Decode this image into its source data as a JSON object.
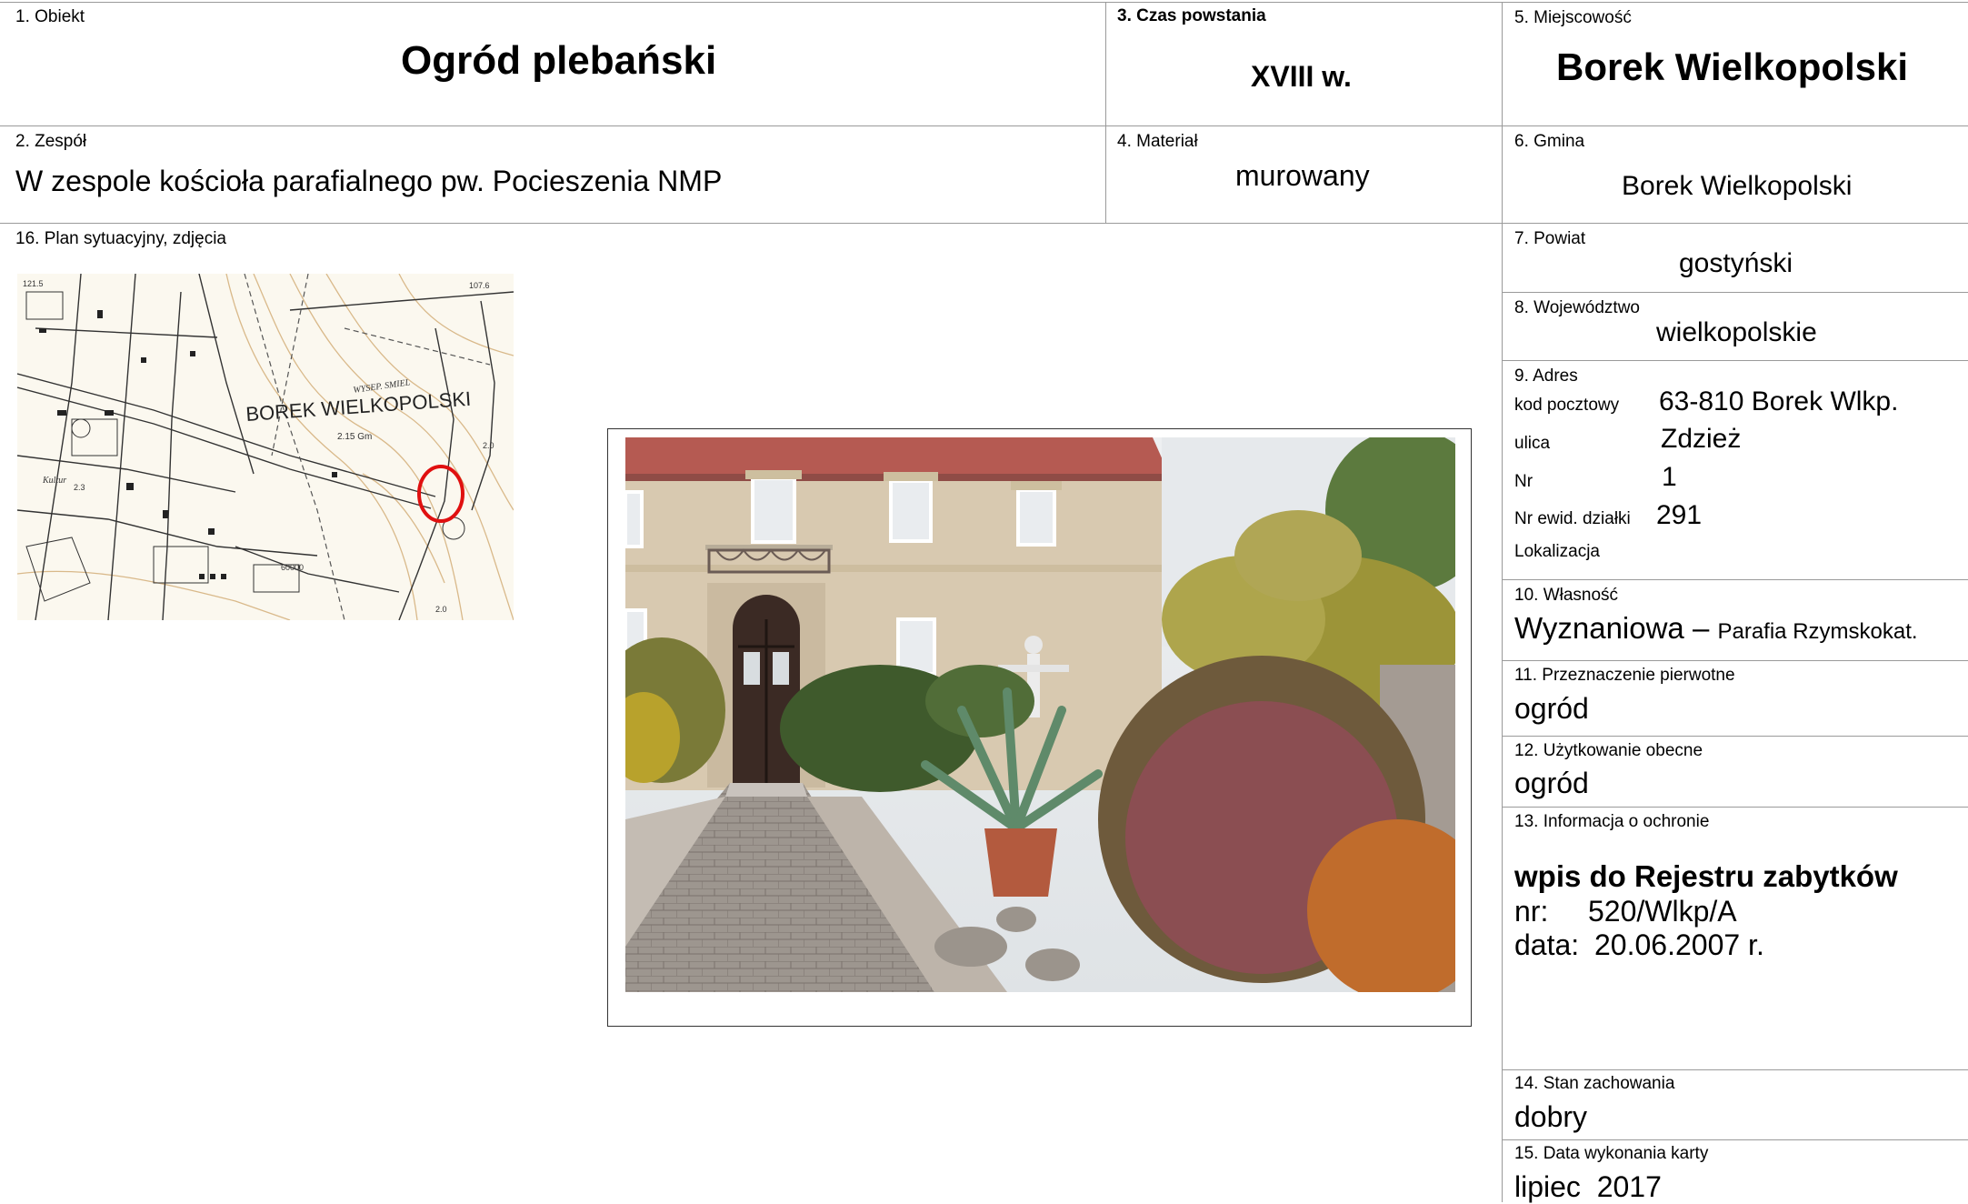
{
  "fields": {
    "obiekt": {
      "label": "1. Obiekt",
      "value": "Ogród plebański"
    },
    "zespol": {
      "label": "2. Zespół",
      "value": "W zespole kościoła parafialnego pw. Pocieszenia NMP"
    },
    "czas": {
      "label": "3. Czas powstania",
      "value": "XVIII w."
    },
    "material": {
      "label": "4. Materiał",
      "value": "murowany"
    },
    "miejscowosc": {
      "label": "5. Miejscowość",
      "value": "Borek Wielkopolski"
    },
    "gmina": {
      "label": "6. Gmina",
      "value": "Borek Wielkopolski"
    },
    "powiat": {
      "label": "7. Powiat",
      "value": "gostyński"
    },
    "wojewodztwo": {
      "label": "8. Województwo",
      "value": "wielkopolskie"
    },
    "adres": {
      "label": "9. Adres",
      "kod_label": "kod pocztowy",
      "kod": "63-810 Borek Wlkp.",
      "ulica_label": "ulica",
      "ulica": "Zdzież",
      "nr_label": "Nr",
      "nr": "1",
      "dzialka_label": "Nr ewid. działki",
      "dzialka": "291",
      "lokalizacja_label": "Lokalizacja"
    },
    "wlasnosc": {
      "label": "10. Własność",
      "value_main": "Wyznaniowa –",
      "value_sub": "Parafia Rzymskokat."
    },
    "przeznaczenie": {
      "label": "11. Przeznaczenie pierwotne",
      "value": "ogród"
    },
    "uzytkowanie": {
      "label": "12. Użytkowanie obecne",
      "value": "ogród"
    },
    "ochrona": {
      "label": "13. Informacja o ochronie",
      "line1": "wpis do Rejestru zabytków",
      "nr_label": "nr:",
      "nr": "520/Wlkp/A",
      "data_label": "data:",
      "data": "20.06.2007 r."
    },
    "stan": {
      "label": "14. Stan zachowania",
      "value": "dobry"
    },
    "data_karty": {
      "label": "15. Data wykonania karty",
      "value": "lipiec  2017"
    },
    "plan": {
      "label": "16. Plan sytuacyjny, zdjęcia"
    }
  },
  "map": {
    "town_label": "BOREK WIELKOPOLSKI",
    "numbers": [
      "121.5",
      "107.6",
      "2.15 Gm",
      "2.0",
      "2.3",
      "60000",
      "2.0"
    ],
    "small_labels": [
      "WYSEP. SMIEL",
      "Kultur"
    ],
    "marker_color": "#e01010"
  }
}
